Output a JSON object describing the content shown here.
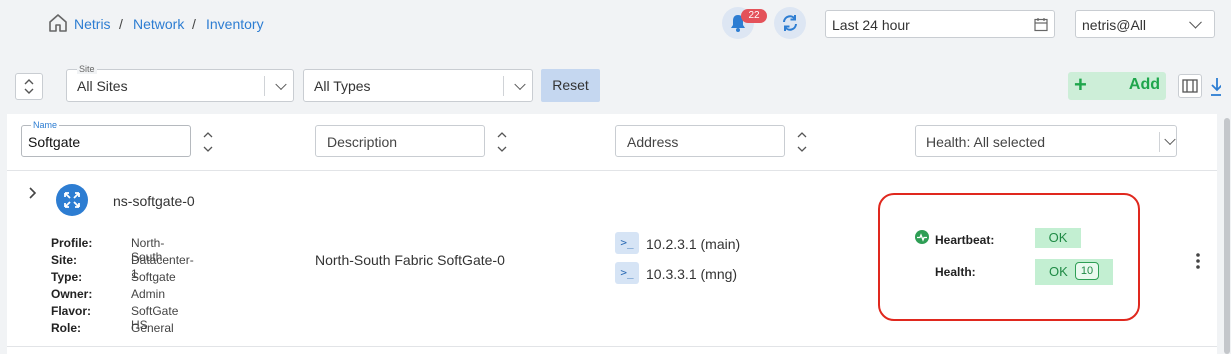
{
  "breadcrumb": [
    "Netris",
    "Network",
    "Inventory"
  ],
  "header": {
    "notification_count": "22",
    "time_range": "Last 24 hour",
    "account": "netris@All"
  },
  "filters": {
    "site_label": "Site",
    "site_value": "All Sites",
    "type_value": "All Types",
    "reset_label": "Reset",
    "add_label": "Add"
  },
  "columns": {
    "name_label": "Name",
    "name_value": "Softgate",
    "description_placeholder": "Description",
    "address_placeholder": "Address",
    "health_value": "Health: All selected"
  },
  "row": {
    "name": "ns-softgate-0",
    "description": "North-South Fabric SoftGate-0",
    "addresses": [
      "10.2.3.1 (main)",
      "10.3.3.1 (mng)"
    ],
    "terminal_glyph": ">_",
    "meta": [
      {
        "key": "Profile:",
        "value": "North-South"
      },
      {
        "key": "Site:",
        "value": "Datacenter-1"
      },
      {
        "key": "Type:",
        "value": "Softgate"
      },
      {
        "key": "Owner:",
        "value": "Admin"
      },
      {
        "key": "Flavor:",
        "value": "SoftGate HS"
      },
      {
        "key": "Role:",
        "value": "General"
      }
    ],
    "heartbeat_label": "Heartbeat:",
    "heartbeat_status": "OK",
    "health_label": "Health:",
    "health_status": "OK",
    "health_count": "10"
  },
  "icons": {
    "home": "home-icon",
    "bell": "bell-icon",
    "refresh": "refresh-icon",
    "calendar": "calendar-icon",
    "expand": "chevron-right-icon",
    "device": "switch-arrows-icon",
    "heartbeat": "heartbeat-icon",
    "more": "more-vertical-icon",
    "download": "download-icon",
    "columns": "columns-icon",
    "plus": "plus-icon"
  },
  "colors": {
    "accent": "#2d7dd2",
    "ok_bg": "#c3efd2",
    "ok_text": "#1f8a45",
    "badge": "#e4525a",
    "highlight": "#e0281e",
    "add_text": "#1fa64c"
  }
}
